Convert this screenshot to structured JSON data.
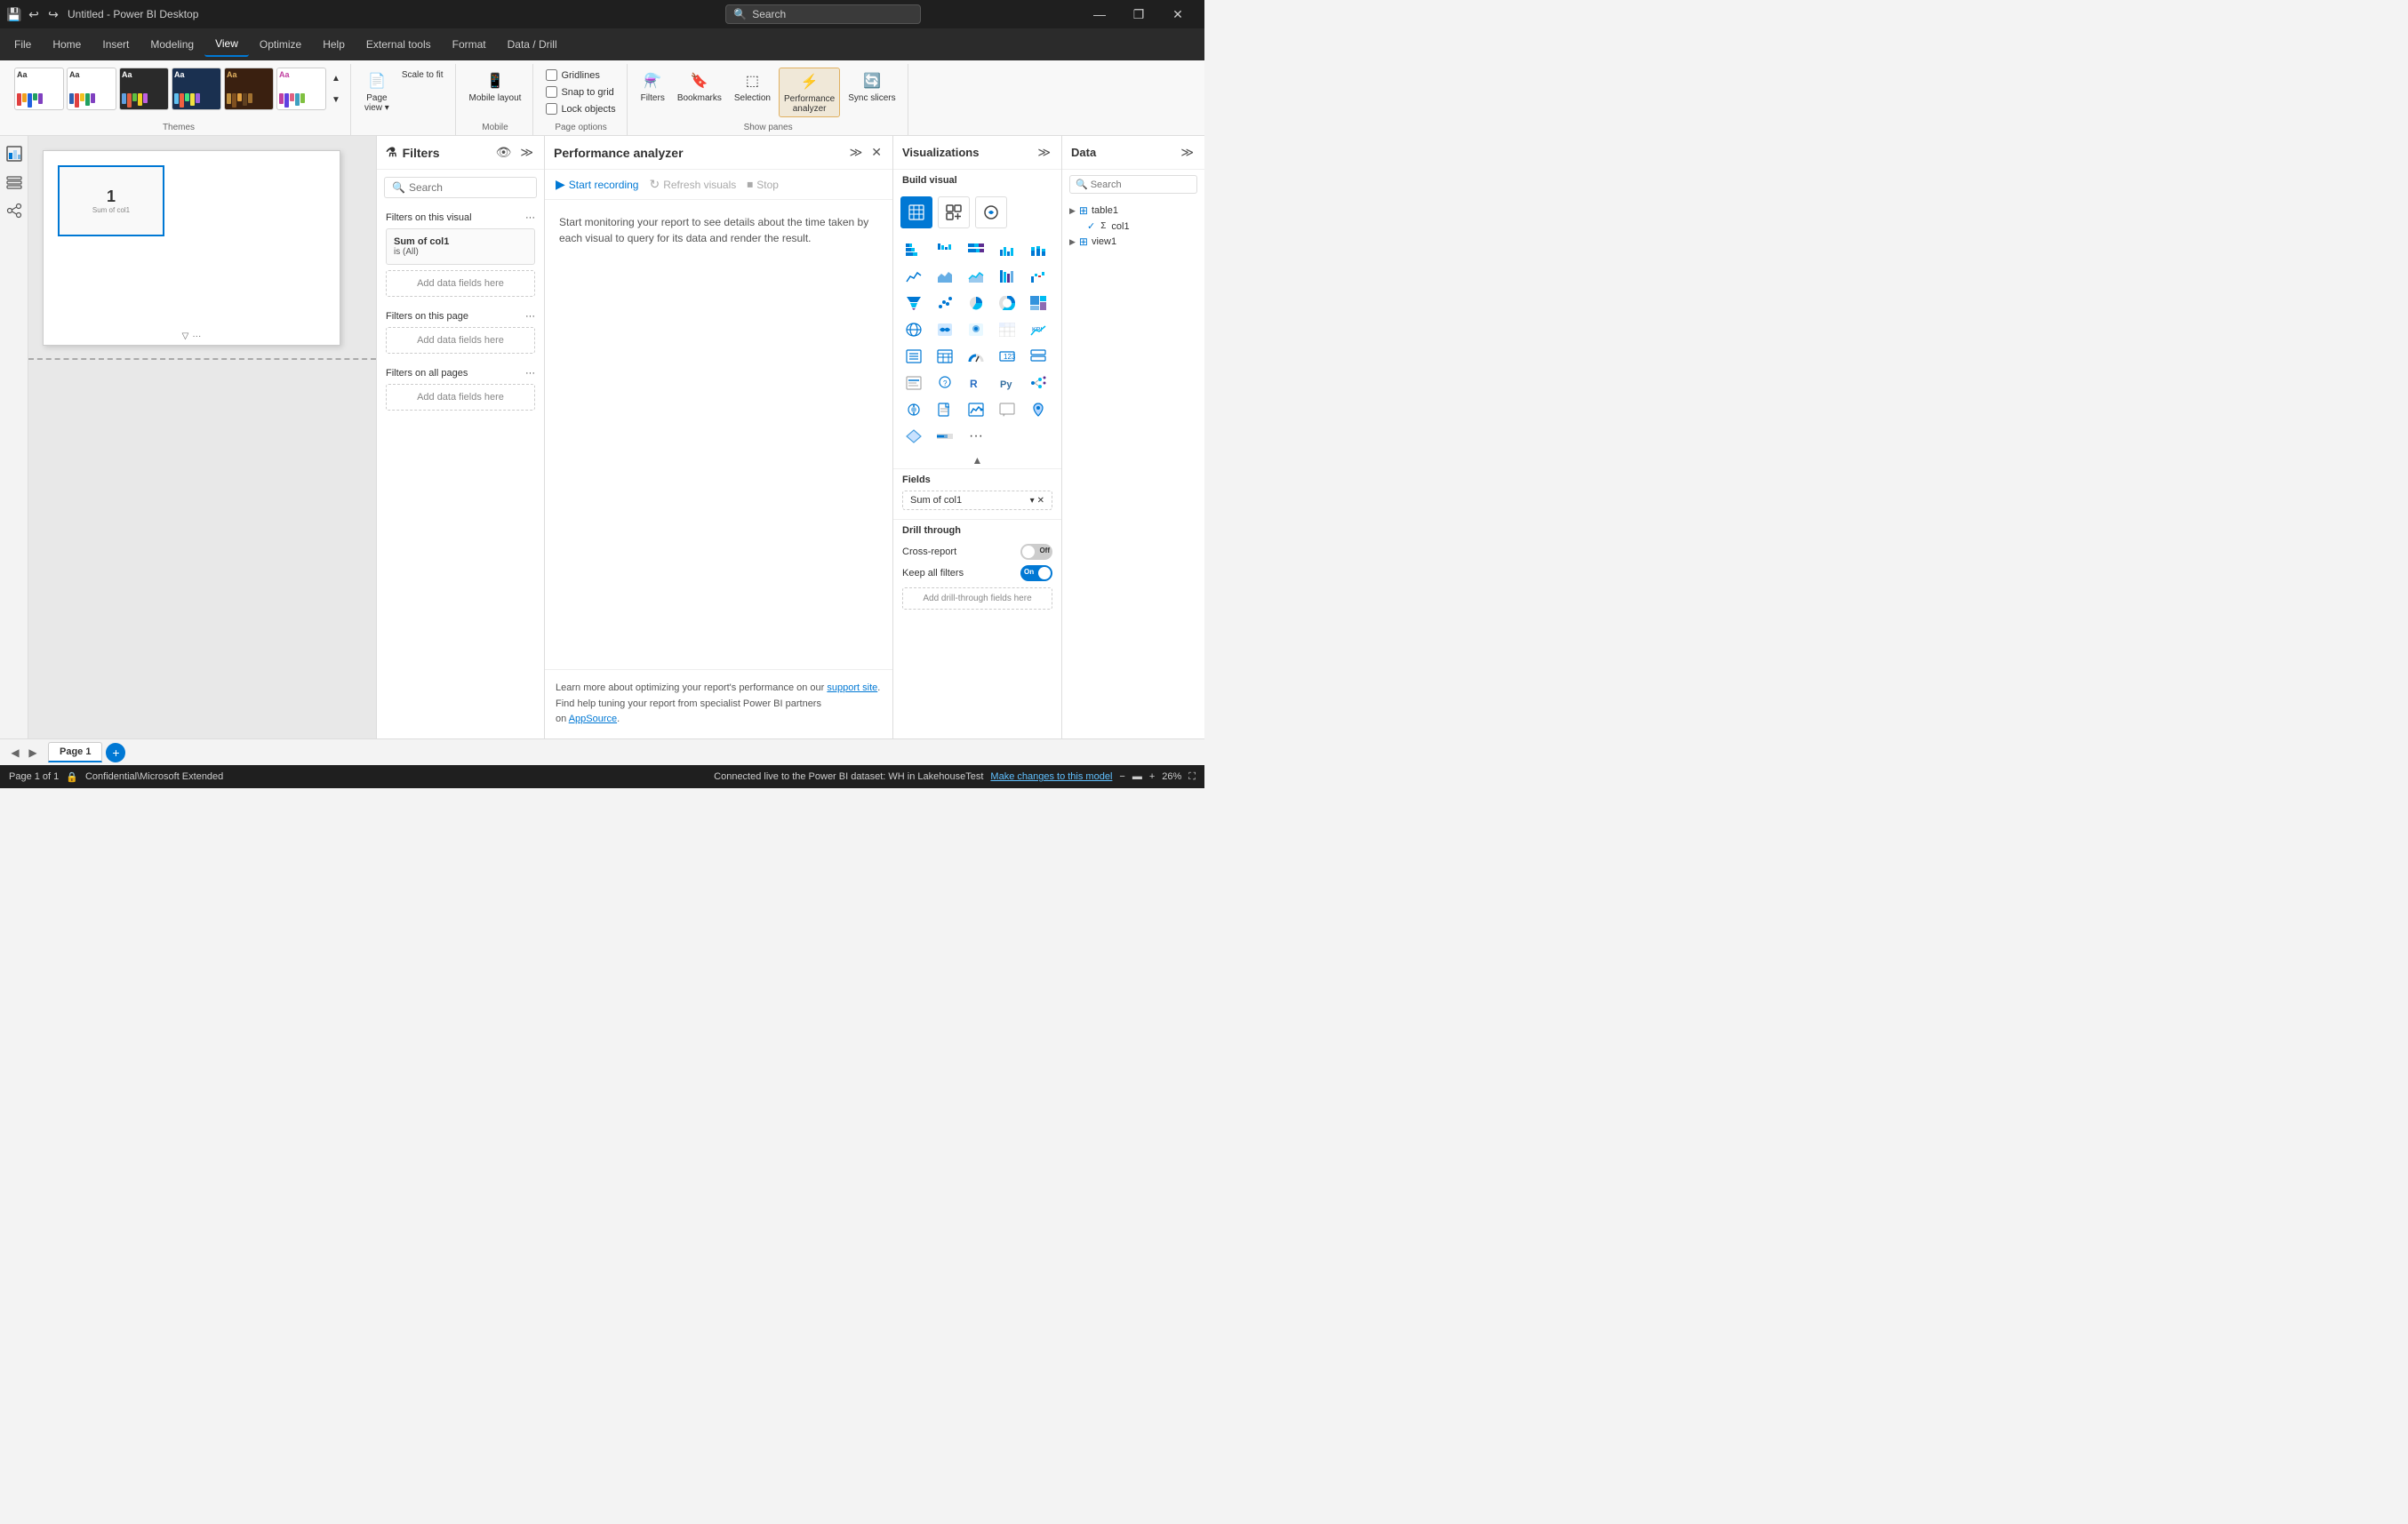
{
  "titlebar": {
    "title": "Untitled - Power BI Desktop",
    "search_placeholder": "Search",
    "save_icon": "💾",
    "undo_icon": "↩",
    "redo_icon": "↪",
    "minimize_label": "—",
    "restore_label": "❐",
    "close_label": "✕"
  },
  "menubar": {
    "items": [
      {
        "label": "File",
        "active": false
      },
      {
        "label": "Home",
        "active": false
      },
      {
        "label": "Insert",
        "active": false
      },
      {
        "label": "Modeling",
        "active": false
      },
      {
        "label": "View",
        "active": true
      },
      {
        "label": "Optimize",
        "active": false
      },
      {
        "label": "Help",
        "active": false
      },
      {
        "label": "External tools",
        "active": false
      },
      {
        "label": "Format",
        "active": false
      },
      {
        "label": "Data / Drill",
        "active": false
      }
    ]
  },
  "ribbon": {
    "themes_label": "Themes",
    "themes": [
      {
        "label": "Aa",
        "id": "t1"
      },
      {
        "label": "Aa",
        "id": "t2"
      },
      {
        "label": "Aa",
        "id": "t3"
      },
      {
        "label": "Aa",
        "id": "t4"
      },
      {
        "label": "Aa",
        "id": "t5"
      },
      {
        "label": "Aa",
        "id": "t6"
      }
    ],
    "page_view_label": "Page view",
    "scale_label": "Scale to fit",
    "mobile_layout_label": "Mobile layout",
    "mobile_label": "Mobile",
    "gridlines_label": "Gridlines",
    "snap_to_grid_label": "Snap to grid",
    "lock_objects_label": "Lock objects",
    "page_options_label": "Page options",
    "filters_label": "Filters",
    "bookmarks_label": "Bookmarks",
    "selection_label": "Selection",
    "performance_analyzer_label": "Performance analyzer",
    "sync_slicers_label": "Sync slicers",
    "show_panes_label": "Show panes"
  },
  "filters_pane": {
    "title": "Filters",
    "search_placeholder": "Search",
    "filters_on_visual_label": "Filters on this visual",
    "filters_on_page_label": "Filters on this page",
    "filters_on_all_label": "Filters on all pages",
    "add_data_fields_label": "Add data fields here",
    "filter_card": {
      "title": "Sum of col1",
      "value": "is (All)"
    },
    "more_options_icon": "···"
  },
  "perf_pane": {
    "title": "Performance analyzer",
    "start_recording_label": "Start recording",
    "refresh_visuals_label": "Refresh visuals",
    "stop_label": "Stop",
    "description": "Start monitoring your report to see details about the time taken by each visual to query for its data and render the result.",
    "footer_text1": "Learn more about optimizing your report's performance on our ",
    "support_site_label": "support site",
    "footer_text2": ".",
    "footer_text3": "Find help tuning your report from specialist Power BI partners",
    "footer_text4": "on ",
    "appsource_label": "AppSource",
    "footer_text5": "."
  },
  "viz_pane": {
    "title": "Visualizations",
    "build_visual_label": "Build visual",
    "fields_label": "Fields",
    "field_chip_label": "Sum of col1",
    "drill_through_label": "Drill through",
    "cross_report_label": "Cross-report",
    "cross_report_toggle": "off",
    "cross_report_toggle_label": "Off",
    "keep_all_filters_label": "Keep all filters",
    "keep_all_filters_toggle": "on",
    "keep_all_filters_toggle_label": "On",
    "drill_add_label": "Add drill-through fields here"
  },
  "data_pane": {
    "title": "Data",
    "search_placeholder": "Search",
    "table1_label": "table1",
    "col1_label": "col1",
    "view1_label": "view1"
  },
  "page_tabs": {
    "current_page_label": "Page 1",
    "add_page_label": "+"
  },
  "statusbar": {
    "page_info": "Page 1 of 1",
    "confidential_label": "Confidential\\Microsoft Extended",
    "connection_info": "Connected live to the Power BI dataset: WH in LakehouseTest",
    "make_changes_label": "Make changes to this model",
    "zoom_label": "26%"
  }
}
